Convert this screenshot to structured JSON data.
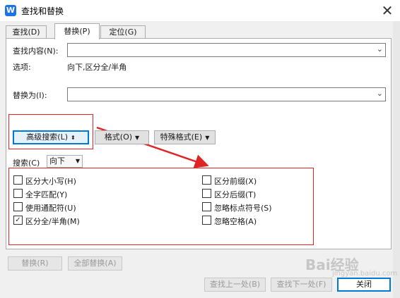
{
  "window": {
    "title": "查找和替换",
    "app_icon": "W",
    "close_glyph": "✕"
  },
  "tabs": [
    {
      "label": "查找(D)",
      "active": false
    },
    {
      "label": "替换(P)",
      "active": true
    },
    {
      "label": "定位(G)",
      "active": false
    }
  ],
  "find": {
    "label": "查找内容(N):",
    "value": ""
  },
  "options": {
    "label": "选项:",
    "value": "向下,区分全/半角"
  },
  "replace": {
    "label": "替换为(I):",
    "value": ""
  },
  "advanced": {
    "button_label": "高级搜索(L)",
    "toggle_glyph": "⬍",
    "format_label": "格式(O)",
    "special_label": "特殊格式(E)",
    "search_label": "搜索(C)",
    "search_direction": "向下"
  },
  "checkboxes_left": [
    {
      "label": "区分大小写(H)",
      "checked": false
    },
    {
      "label": "全字匹配(Y)",
      "checked": false
    },
    {
      "label": "使用通配符(U)",
      "checked": false
    },
    {
      "label": "区分全/半角(M)",
      "checked": true
    }
  ],
  "checkboxes_right": [
    {
      "label": "区分前缀(X)",
      "checked": false
    },
    {
      "label": "区分后缀(T)",
      "checked": false
    },
    {
      "label": "忽略标点符号(S)",
      "checked": false
    },
    {
      "label": "忽略空格(A)",
      "checked": false
    }
  ],
  "bottom": {
    "replace": "替换(R)",
    "replace_all": "全部替换(A)",
    "find_prev": "查找上一处(B)",
    "find_next": "查找下一处(F)",
    "close": "关闭"
  },
  "watermark": {
    "text": "Bai经验",
    "sub": "jingyan.baidu.com"
  },
  "colors": {
    "highlight": "#e02424",
    "accent": "#0078d7"
  }
}
